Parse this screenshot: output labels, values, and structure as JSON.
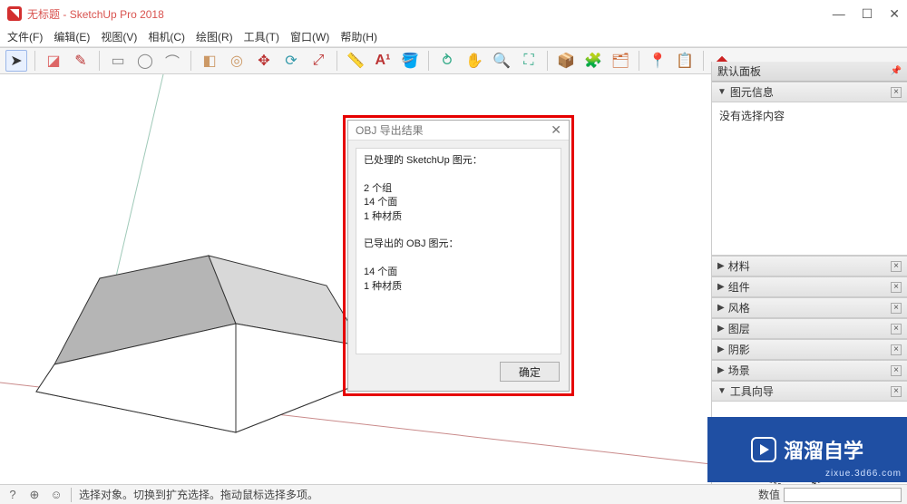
{
  "titlebar": {
    "doc_title": "无标题",
    "app_name": "SketchUp Pro 2018"
  },
  "menubar": {
    "items": [
      "文件(F)",
      "编辑(E)",
      "视图(V)",
      "相机(C)",
      "绘图(R)",
      "工具(T)",
      "窗口(W)",
      "帮助(H)"
    ]
  },
  "tray": {
    "title": "默认面板",
    "entity_info": {
      "label": "图元信息",
      "body": "没有选择内容",
      "expanded": true
    },
    "panels": [
      {
        "label": "材料"
      },
      {
        "label": "组件"
      },
      {
        "label": "风格"
      },
      {
        "label": "图层"
      },
      {
        "label": "阴影"
      },
      {
        "label": "场景"
      }
    ],
    "instructor": {
      "label": "工具向导",
      "expanded": true
    }
  },
  "dialog": {
    "title": "OBJ 导出结果",
    "body_lines": [
      "已处理的 SketchUp 图元：",
      "",
      "2 个组",
      "14 个面",
      "1 种材质",
      "",
      "已导出的 OBJ 图元：",
      "",
      "14 个面",
      "1 种材质"
    ],
    "ok": "确定"
  },
  "status": {
    "text": "选择对象。切换到扩充选择。拖动鼠标选择多项。",
    "measure_label": "数值",
    "measure_value": ""
  },
  "watermark": {
    "brand": "溜溜自学",
    "sub": "zixue.3d66.com"
  },
  "extra_label": "要修",
  "toolbar_icons": [
    "select",
    "eraser",
    "pencil",
    "line-divider",
    "rect",
    "circle",
    "arc",
    "divider",
    "pushpull",
    "offset",
    "move",
    "rotate",
    "scale",
    "divider",
    "tape",
    "text",
    "paint",
    "divider",
    "orbit",
    "pan",
    "zoom",
    "zoom-extents",
    "divider",
    "3dwarehouse",
    "extwarehouse",
    "layermgr",
    "divider",
    "addlocation",
    "outliner",
    "preview",
    "divider",
    "ruby"
  ]
}
